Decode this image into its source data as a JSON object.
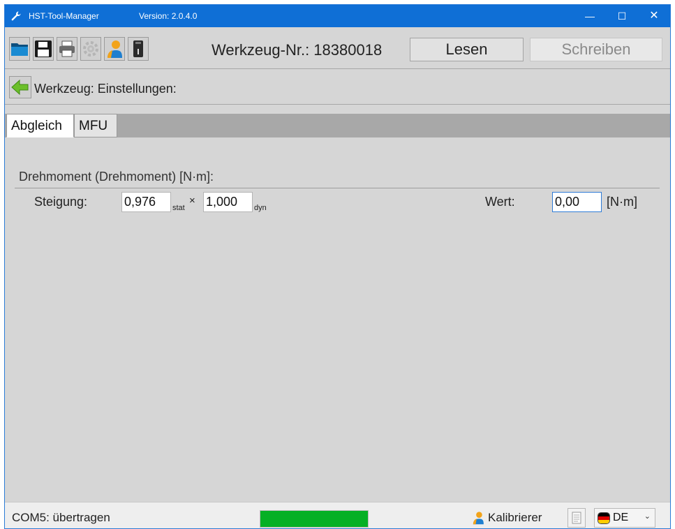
{
  "window": {
    "app_title": "HST-Tool-Manager",
    "version": "Version: 2.0.4.0",
    "controls": {
      "minimize": "—",
      "maximize": "☐",
      "close": "✕"
    }
  },
  "toolbar": {
    "icons": [
      "open-folder-icon",
      "save-icon",
      "print-icon",
      "settings-icon",
      "user-icon",
      "usb-device-icon"
    ],
    "tool_number_label": "Werkzeug-Nr.: 18380018",
    "read_button": "Lesen",
    "write_button": "Schreiben"
  },
  "section": {
    "title": "Werkzeug: Einstellungen:"
  },
  "tabs": [
    {
      "label": "Abgleich",
      "active": true
    },
    {
      "label": "MFU",
      "active": false
    }
  ],
  "group": {
    "title": "Drehmoment (Drehmoment) [N·m]:",
    "slope_label": "Steigung:",
    "stat_value": "0,976",
    "stat_sub": "stat",
    "times": "×",
    "dyn_value": "1,000",
    "dyn_sub": "dyn",
    "value_label": "Wert:",
    "value": "0,00",
    "unit": "[N·m]"
  },
  "statusbar": {
    "status_text": "COM5: übertragen",
    "progress_percent": 100,
    "progress_color": "#06b025",
    "user_label": "Kalibrierer",
    "language_code": "DE"
  },
  "colors": {
    "titlebar": "#0f6fd6",
    "background": "#d6d6d6",
    "tab_strip": "#a8a8a8"
  }
}
